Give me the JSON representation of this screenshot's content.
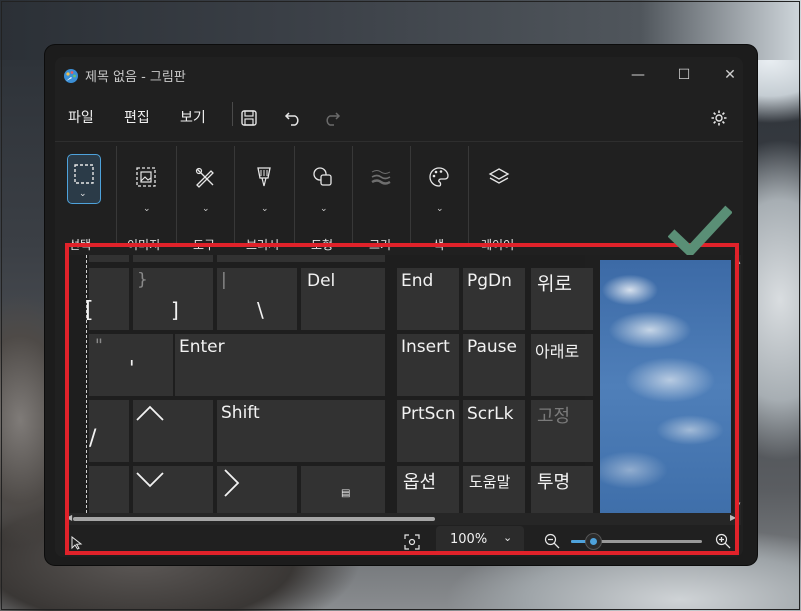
{
  "window": {
    "title": "제목 없음 - 그림판",
    "controls": {
      "minimize": "—",
      "maximize": "☐",
      "close": "✕"
    }
  },
  "menu": {
    "file": "파일",
    "edit": "편집",
    "view": "보기"
  },
  "ribbon": {
    "groups": [
      {
        "label": "선택",
        "icon": "selection-icon"
      },
      {
        "label": "이미지",
        "icon": "image-icon"
      },
      {
        "label": "도구",
        "icon": "tools-icon"
      },
      {
        "label": "브러시",
        "icon": "brush-icon"
      },
      {
        "label": "도형",
        "icon": "shapes-icon"
      },
      {
        "label": "크기",
        "icon": "size-icon"
      },
      {
        "label": "색",
        "icon": "palette-icon"
      },
      {
        "label": "레이어",
        "icon": "layers-icon"
      }
    ]
  },
  "keyboard": {
    "brace_open": "{",
    "bracket_open": "[",
    "brace_close": "}",
    "bracket_close": "]",
    "pipe": "|",
    "backslash": "\\",
    "del": "Del",
    "end": "End",
    "pgdn": "PgDn",
    "up": "위로",
    "quote_dbl": "\"",
    "quote_sgl": "'",
    "enter": "Enter",
    "insert": "Insert",
    "pause": "Pause",
    "down_kr": "아래로",
    "slash": "/",
    "caret": "^",
    "shift": "Shift",
    "prtscn": "PrtScn",
    "scrlk": "ScrLk",
    "fix": "고정",
    "vee": "V",
    "gt": ">",
    "options": "옵션",
    "help": "도움말",
    "transparent": "투명"
  },
  "status": {
    "zoom_level": "100%"
  },
  "colors": {
    "highlight": "#e0222a",
    "accent": "#4ea2db",
    "check": "#5a8f76"
  },
  "zoom_slider_fraction": 0.17
}
